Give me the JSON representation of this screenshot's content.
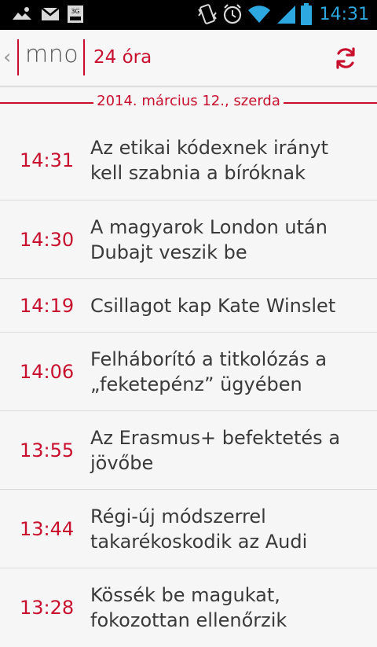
{
  "status_bar": {
    "time": "14:31",
    "network_badge": "3G",
    "colors": {
      "background": "#000000",
      "time": "#2ea8e0",
      "icons": "#d9d9d9"
    }
  },
  "app_bar": {
    "logo": "mno",
    "title": "24 óra",
    "back_glyph": "‹",
    "accent": "#c8102e"
  },
  "date_header": "2014. március 12., szerda",
  "news": [
    {
      "time": "14:31",
      "headline": "Az etikai kódexnek irányt kell szabnia a bíróknak"
    },
    {
      "time": "14:30",
      "headline": "A magyarok London után Dubajt veszik be"
    },
    {
      "time": "14:19",
      "headline": "Csillagot kap Kate Winslet"
    },
    {
      "time": "14:06",
      "headline": "Felháborító a titkolózás a „feketepénz” ügyében"
    },
    {
      "time": "13:55",
      "headline": "Az Erasmus+ befektetés a jövőbe"
    },
    {
      "time": "13:44",
      "headline": "Régi-új módszerrel takarékoskodik az Audi"
    },
    {
      "time": "13:28",
      "headline": "Kössék be magukat, fokozottan ellenőrzik"
    }
  ],
  "icons": [
    "photo-notification-icon",
    "gmail-icon",
    "3g-data-icon",
    "vibrate-icon",
    "alarm-icon",
    "wifi-icon",
    "signal-icon",
    "battery-icon",
    "back-chevron-icon",
    "refresh-icon"
  ]
}
